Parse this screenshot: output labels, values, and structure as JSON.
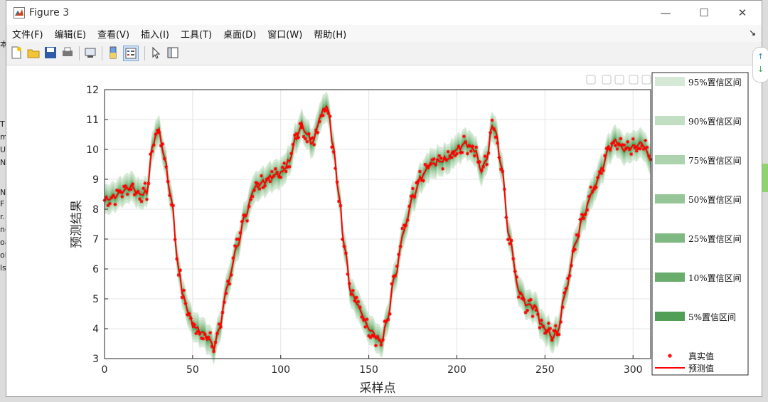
{
  "window": {
    "title": "Figure 3",
    "minimize_glyph": "—",
    "maximize_glyph": "☐",
    "close_glyph": "✕"
  },
  "menu": {
    "items": [
      "文件(F)",
      "编辑(E)",
      "查看(V)",
      "插入(I)",
      "工具(T)",
      "桌面(D)",
      "窗口(W)",
      "帮助(H)"
    ],
    "overflow_glyph": "↘"
  },
  "toolbar": {
    "icons": [
      "new-figure-icon",
      "open-file-icon",
      "save-icon",
      "print-icon",
      "link-plot-icon",
      "insert-colorbar-icon",
      "insert-legend-icon",
      "edit-plot-arrow-icon",
      "property-inspector-icon"
    ]
  },
  "left_strip": [
    "本",
    "T",
    "m",
    "U",
    "N",
    "N",
    "F",
    "r.",
    "ne",
    "oa",
    "ol",
    "ls"
  ],
  "axes_toolbar": {
    "icons": [
      "brush-icon",
      "data-tips-icon",
      "pan-icon",
      "zoom-in-icon",
      "zoom-out-icon",
      "home-icon"
    ]
  },
  "colors": {
    "prediction": "#ff0000",
    "true_marker": "#ff0000",
    "band_95": "#d6e9d6",
    "band_90": "#c2dfc3",
    "band_75": "#acd3ad",
    "band_50": "#96c698",
    "band_25": "#7fb982",
    "band_10": "#69ad6d",
    "band_5": "#519e56"
  },
  "chart_data": {
    "type": "line",
    "xlabel": "采样点",
    "ylabel": "预测结果",
    "xlim": [
      0,
      310
    ],
    "ylim": [
      3,
      12
    ],
    "xticks": [
      0,
      50,
      100,
      150,
      200,
      250,
      300
    ],
    "yticks": [
      3,
      4,
      5,
      6,
      7,
      8,
      9,
      10,
      11,
      12
    ],
    "grid": true,
    "legend_placement": "outside-right",
    "prediction_knots": [
      [
        0,
        8.3
      ],
      [
        5,
        8.4
      ],
      [
        10,
        8.6
      ],
      [
        15,
        8.75
      ],
      [
        20,
        8.5
      ],
      [
        24,
        8.55
      ],
      [
        27,
        10.0
      ],
      [
        29,
        10.5
      ],
      [
        31,
        10.6
      ],
      [
        34,
        9.7
      ],
      [
        38,
        8.3
      ],
      [
        42,
        6.0
      ],
      [
        45,
        5.0
      ],
      [
        48,
        4.5
      ],
      [
        50,
        4.1
      ],
      [
        55,
        3.9
      ],
      [
        60,
        3.6
      ],
      [
        62,
        3.35
      ],
      [
        65,
        4.0
      ],
      [
        70,
        5.5
      ],
      [
        75,
        6.7
      ],
      [
        80,
        7.8
      ],
      [
        85,
        8.7
      ],
      [
        90,
        8.9
      ],
      [
        95,
        9.1
      ],
      [
        100,
        9.2
      ],
      [
        105,
        9.6
      ],
      [
        108,
        10.3
      ],
      [
        112,
        10.8
      ],
      [
        115,
        10.5
      ],
      [
        118,
        10.2
      ],
      [
        122,
        11.0
      ],
      [
        125,
        11.45
      ],
      [
        127,
        11.3
      ],
      [
        130,
        10.0
      ],
      [
        133,
        8.5
      ],
      [
        136,
        6.8
      ],
      [
        140,
        5.2
      ],
      [
        143,
        4.9
      ],
      [
        146,
        4.5
      ],
      [
        150,
        4.0
      ],
      [
        155,
        3.7
      ],
      [
        157,
        3.5
      ],
      [
        160,
        4.2
      ],
      [
        165,
        5.8
      ],
      [
        170,
        7.3
      ],
      [
        175,
        8.4
      ],
      [
        180,
        9.1
      ],
      [
        185,
        9.5
      ],
      [
        190,
        9.6
      ],
      [
        195,
        9.7
      ],
      [
        200,
        10.0
      ],
      [
        205,
        10.2
      ],
      [
        210,
        10.0
      ],
      [
        214,
        9.3
      ],
      [
        217,
        9.7
      ],
      [
        220,
        10.8
      ],
      [
        222,
        10.6
      ],
      [
        225,
        9.5
      ],
      [
        230,
        7.0
      ],
      [
        235,
        5.3
      ],
      [
        240,
        4.8
      ],
      [
        245,
        4.7
      ],
      [
        248,
        4.1
      ],
      [
        252,
        3.9
      ],
      [
        254,
        3.7
      ],
      [
        257,
        3.9
      ],
      [
        262,
        5.3
      ],
      [
        267,
        6.8
      ],
      [
        272,
        7.8
      ],
      [
        277,
        8.6
      ],
      [
        282,
        9.3
      ],
      [
        286,
        10.0
      ],
      [
        290,
        10.3
      ],
      [
        295,
        10.0
      ],
      [
        300,
        10.1
      ],
      [
        305,
        10.2
      ],
      [
        310,
        9.7
      ]
    ],
    "legend": [
      "95%置信区间",
      "90%置信区间",
      "75%置信区间",
      "50%置信区间",
      "25%置信区间",
      "10%置信区间",
      "5%置信区间",
      "真实值",
      "预测值"
    ]
  }
}
